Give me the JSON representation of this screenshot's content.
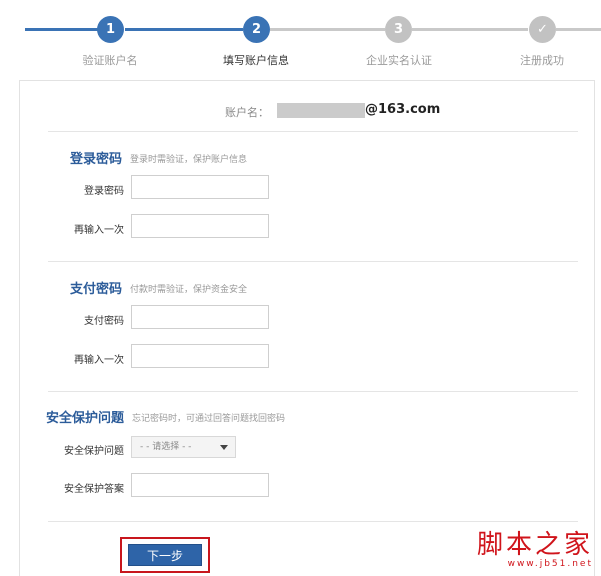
{
  "steps": [
    {
      "number": "1",
      "label": "验证账户名",
      "state": "done"
    },
    {
      "number": "2",
      "label": "填写账户信息",
      "state": "current"
    },
    {
      "number": "3",
      "label": "企业实名认证",
      "state": "pending"
    },
    {
      "number": "✓",
      "label": "注册成功",
      "state": "pending"
    }
  ],
  "account": {
    "label": "账户名：",
    "domain": "@163.com"
  },
  "login_password": {
    "title": "登录密码",
    "hint": "登录时需验证，保护账户信息",
    "field1_label": "登录密码",
    "field2_label": "再输入一次"
  },
  "pay_password": {
    "title": "支付密码",
    "hint": "付款时需验证，保护资金安全",
    "field1_label": "支付密码",
    "field2_label": "再输入一次"
  },
  "security": {
    "title": "安全保护问题",
    "hint": "忘记密码时，可通过回答问题找回密码",
    "question_label": "安全保护问题",
    "question_selected": "- - 请选择 - -",
    "answer_label": "安全保护答案"
  },
  "next_button": "下一步",
  "watermark": {
    "main": "脚本之家",
    "sub": "www.jb51.net"
  },
  "colors": {
    "accent": "#3a73b5",
    "highlight": "#c8161d",
    "watermark": "#d0141b"
  }
}
